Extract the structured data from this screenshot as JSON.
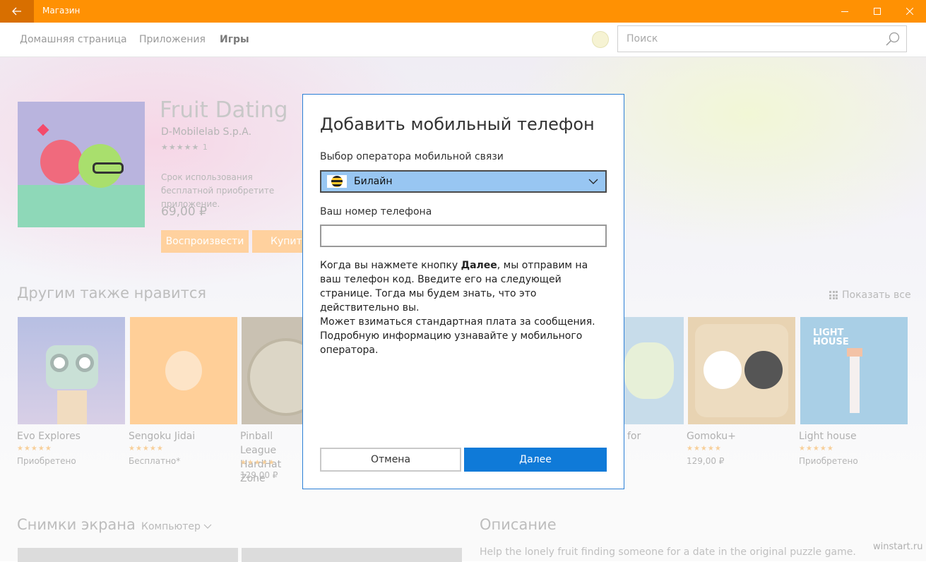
{
  "window": {
    "title": "Магазин",
    "accent_color": "#FF9103",
    "back_button_color": "#D86F00"
  },
  "nav": {
    "items": [
      {
        "label": "Домашняя страница"
      },
      {
        "label": "Приложения"
      },
      {
        "label": "Игры",
        "active": true
      }
    ],
    "search_placeholder": "Поиск"
  },
  "app": {
    "name": "Fruit Dating",
    "publisher": "D-Mobilelab S.p.A.",
    "rating_stars": "★★★★★",
    "rating_count": "1",
    "trial_text": "Срок использования бесплатной приобретите приложение.",
    "price": "69,00 ₽",
    "play_label": "Воспроизвести",
    "buy_label": "Купить"
  },
  "also_like": {
    "title": "Другим также нравится",
    "show_all": "Показать все",
    "items": [
      {
        "name": "Evo Explores",
        "stars": "★★★★★",
        "status": "Приобретено"
      },
      {
        "name": "Sengoku Jidai",
        "stars": "★★★★★",
        "status": "Бесплатно*"
      },
      {
        "name": "Pinball League HardHat Zone",
        "stars": "★★★★★",
        "status": "129,00 ₽"
      },
      {
        "name": "for",
        "stars": "",
        "status": ""
      },
      {
        "name": "Gomoku+",
        "stars": "★★★★★",
        "status": "129,00 ₽"
      },
      {
        "name": "Light house",
        "stars": "★★★★★",
        "status": "Приобретено"
      }
    ],
    "light_house_logo": "LIGHT HOUSE"
  },
  "screenshots": {
    "title": "Снимки экрана",
    "filter": "Компьютер"
  },
  "description": {
    "title": "Описание",
    "text": "Help the lonely fruit finding someone for a date in the original puzzle game."
  },
  "watermark": "winstart.ru",
  "dialog": {
    "title": "Добавить мобильный телефон",
    "operator_label": "Выбор оператора мобильной связи",
    "operator_value": "Билайн",
    "phone_label": "Ваш номер телефона",
    "phone_value": "",
    "para1_before": "Когда вы нажмете кнопку ",
    "para1_bold": "Далее",
    "para1_after": ", мы отправим на ваш телефон код. Введите его на следующей странице. Тогда мы будем знать, что это действительно вы.",
    "para2": "Может взиматься стандартная плата за сообщения. Подробную информацию узнавайте у мобильного оператора.",
    "cancel_label": "Отмена",
    "next_label": "Далее",
    "accent_color": "#0F7AD8"
  }
}
